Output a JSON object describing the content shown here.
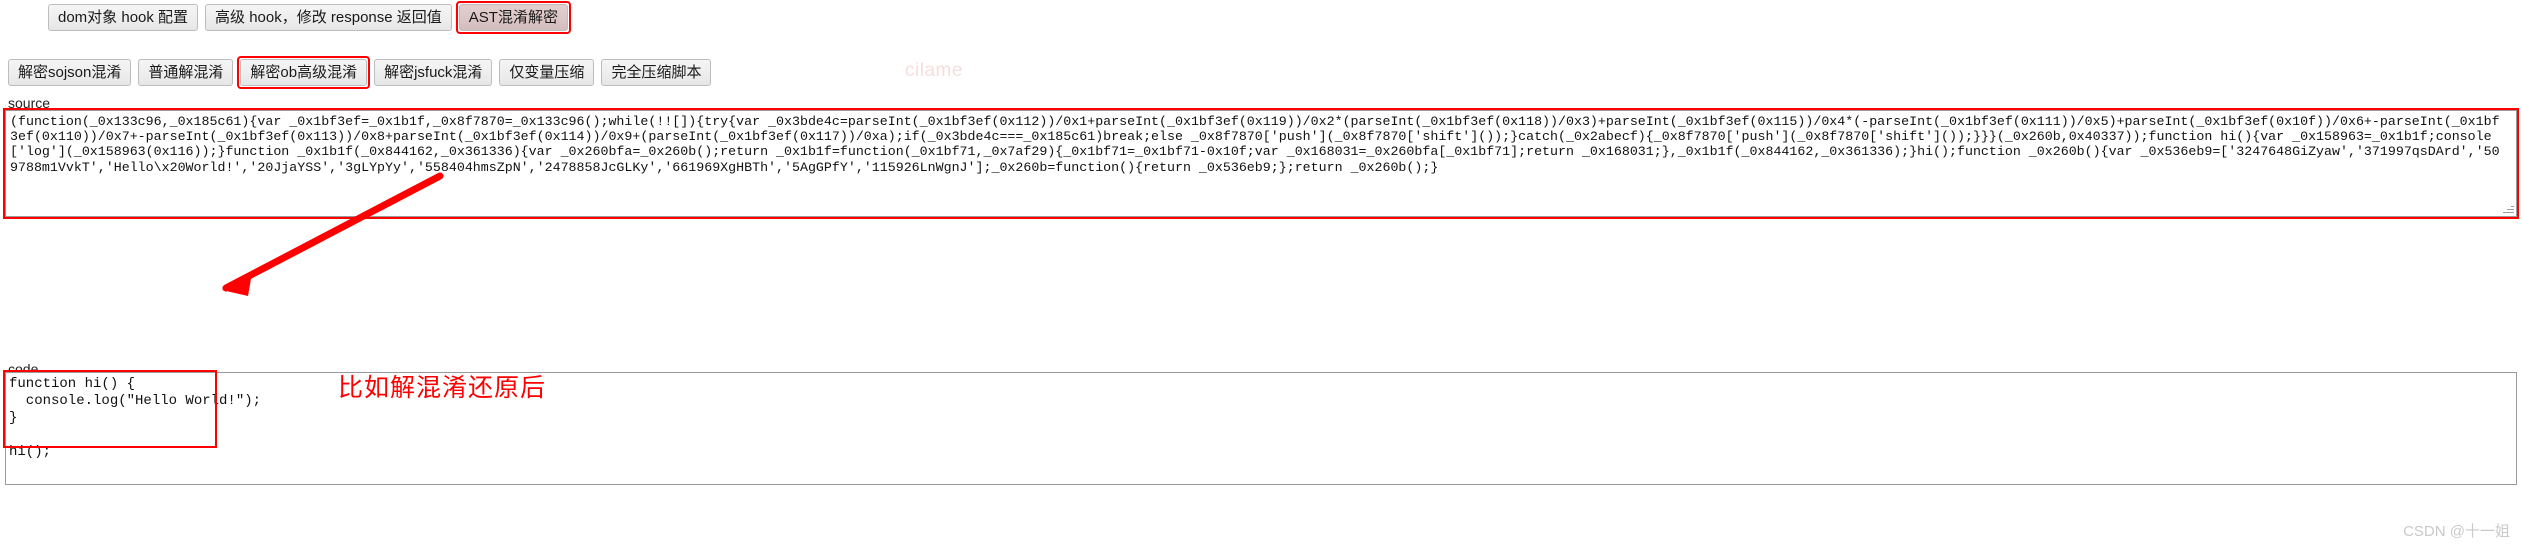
{
  "toolbar_top": {
    "buttons": [
      {
        "label": "dom对象 hook 配置",
        "highlighted": false
      },
      {
        "label": "高级 hook，修改 response 返回值",
        "highlighted": false
      },
      {
        "label": "AST混淆解密",
        "highlighted": true
      }
    ]
  },
  "toolbar_second": {
    "buttons": [
      {
        "label": "解密sojson混淆",
        "highlighted": false
      },
      {
        "label": "普通解混淆",
        "highlighted": false
      },
      {
        "label": "解密ob高级混淆",
        "highlighted": true
      },
      {
        "label": "解密jsfuck混淆",
        "highlighted": false
      },
      {
        "label": "仅变量压缩",
        "highlighted": false
      },
      {
        "label": "完全压缩脚本",
        "highlighted": false
      }
    ]
  },
  "watermarks": {
    "cilame": "cilame",
    "csdn": "CSDN @十一姐"
  },
  "source_field": {
    "label": "source",
    "value": "(function(_0x133c96,_0x185c61){var _0x1bf3ef=_0x1b1f,_0x8f7870=_0x133c96();while(!![]){try{var _0x3bde4c=parseInt(_0x1bf3ef(0x112))/0x1+parseInt(_0x1bf3ef(0x119))/0x2*(parseInt(_0x1bf3ef(0x118))/0x3)+parseInt(_0x1bf3ef(0x115))/0x4*(-parseInt(_0x1bf3ef(0x111))/0x5)+parseInt(_0x1bf3ef(0x10f))/0x6+-parseInt(_0x1bf3ef(0x110))/0x7+-parseInt(_0x1bf3ef(0x113))/0x8+parseInt(_0x1bf3ef(0x114))/0x9+(parseInt(_0x1bf3ef(0x117))/0xa);if(_0x3bde4c===_0x185c61)break;else _0x8f7870['push'](_0x8f7870['shift']());}catch(_0x2abecf){_0x8f7870['push'](_0x8f7870['shift']());}}}(_0x260b,0x40337));function hi(){var _0x158963=_0x1b1f;console['log'](_0x158963(0x116));}function _0x1b1f(_0x844162,_0x361336){var _0x260bfa=_0x260b();return _0x1b1f=function(_0x1bf71,_0x7af29){_0x1bf71=_0x1bf71-0x10f;var _0x168031=_0x260bfa[_0x1bf71];return _0x168031;},_0x1b1f(_0x844162,_0x361336);}hi();function _0x260b(){var _0x536eb9=['3247648GiZyaw','371997qsDArd','509788m1VvkT','Hello\\x20World!','20JjaYSS','3gLYpYy','558404hmsZpN','2478858JcGLKy','661969XgHBTh','5AgGPfY','115926LnWgnJ'];_0x260b=function(){return _0x536eb9;};return _0x260b();}"
  },
  "code_field": {
    "label": "code",
    "value": "function hi() {\n  console.log(\"Hello World!\");\n}\n\nhi();"
  },
  "annotation": {
    "text": "比如解混淆还原后",
    "color": "#ff0000"
  },
  "colors": {
    "highlight": "#ff0000",
    "button_face": "#efefef",
    "button_border": "#bdbdbd",
    "field_border": "#9a9a9a",
    "watermark": "#c9c9c9"
  }
}
